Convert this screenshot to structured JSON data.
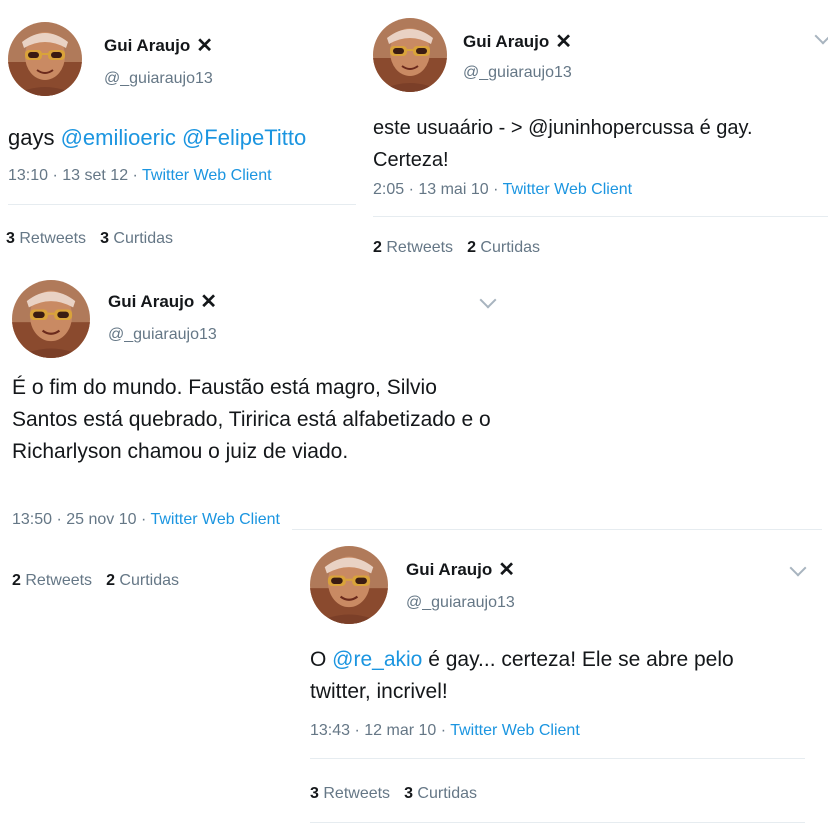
{
  "tweets": [
    {
      "name": "Gui Araujo",
      "verified_icon": "x-mark-icon",
      "handle": "@_guiaraujo13",
      "text_parts": [
        "gays ",
        "@emilioeric",
        " ",
        "@FelipeTitto"
      ],
      "time": "13:10 · 13 set 12 · ",
      "client": "Twitter Web Client",
      "retweets_count": "3",
      "retweets_label": "Retweets",
      "likes_count": "3",
      "likes_label": "Curtidas"
    },
    {
      "name": "Gui Araujo",
      "verified_icon": "x-mark-icon",
      "handle": "@_guiaraujo13",
      "text": "este usuaário - > @juninhopercussa é gay. Certeza!",
      "time": "2:05 · 13 mai 10 · ",
      "client": "Twitter Web Client",
      "retweets_count": "2",
      "retweets_label": "Retweets",
      "likes_count": "2",
      "likes_label": "Curtidas"
    },
    {
      "name": "Gui Araujo",
      "verified_icon": "x-mark-icon",
      "handle": "@_guiaraujo13",
      "text": "É o fim do mundo. Faustão está magro, Silvio Santos está quebrado, Tiririca está alfabetizado e o Richarlyson chamou o juiz de viado.",
      "time": "13:50 · 25 nov 10 · ",
      "client": "Twitter Web Client",
      "retweets_count": "2",
      "retweets_label": "Retweets",
      "likes_count": "2",
      "likes_label": "Curtidas"
    },
    {
      "name": "Gui Araujo",
      "verified_icon": "x-mark-icon",
      "handle": "@_guiaraujo13",
      "text_parts": [
        "O ",
        "@re_akio",
        " é gay... certeza! Ele se abre pelo twitter, incrivel!"
      ],
      "time": "13:43 · 12 mar 10 · ",
      "client": "Twitter Web Client",
      "retweets_count": "3",
      "retweets_label": "Retweets",
      "likes_count": "3",
      "likes_label": "Curtidas"
    }
  ],
  "colors": {
    "text": "#14171a",
    "secondary": "#657786",
    "link": "#1b95e0",
    "divider": "#e6ecf0"
  }
}
